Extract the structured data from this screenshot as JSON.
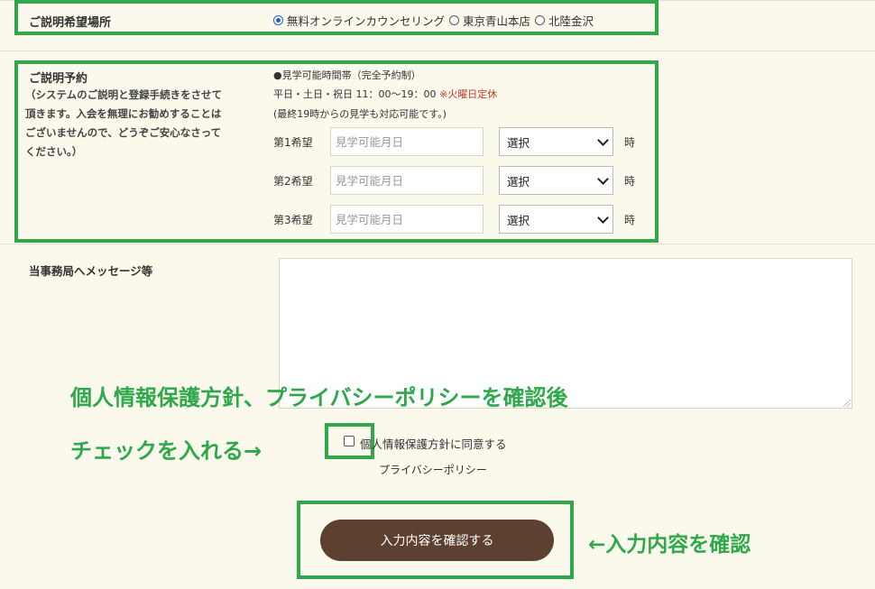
{
  "location": {
    "label": "ご説明希望場所",
    "options": [
      {
        "label": "無料オンラインカウンセリング",
        "selected": true
      },
      {
        "label": "東京青山本店",
        "selected": false
      },
      {
        "label": "北陸金沢",
        "selected": false
      }
    ]
  },
  "reservation": {
    "title": "ご説明予約",
    "note": "（システムのご説明と登録手続きをさせて頂きます。入会を無理にお勧めすることはございませんので、どうぞご安心なさってください。）",
    "info_line1": "●見学可能時間帯（完全予約制）",
    "info_line2": "平日・土日・祝日 11：00〜19：00 ",
    "info_line2_red": "※火曜日定休",
    "info_line3": "(最終19時からの見学も対応可能です。)",
    "preferences": [
      {
        "label": "第1希望",
        "date_placeholder": "見学可能月日",
        "select_value": "選択",
        "hour": "時"
      },
      {
        "label": "第2希望",
        "date_placeholder": "見学可能月日",
        "select_value": "選択",
        "hour": "時"
      },
      {
        "label": "第3希望",
        "date_placeholder": "見学可能月日",
        "select_value": "選択",
        "hour": "時"
      }
    ]
  },
  "message": {
    "label": "当事務局へメッセージ等",
    "value": ""
  },
  "annotations": {
    "privacy_check": "個人情報保護方針、プライバシーポリシーを確認後",
    "check_it": "チェックを入れる→",
    "confirm_hint": "←入力内容を確認"
  },
  "agreement": {
    "checkbox_label": "個人情報保護方針に同意する",
    "checked": false,
    "privacy_link": "プライバシーポリシー"
  },
  "confirm_button": "入力内容を確認する",
  "colors": {
    "annotation_green": "#2ea84a",
    "button_brown": "#5d4030",
    "background": "#fbf8ec",
    "notice_red": "#c0392b"
  }
}
